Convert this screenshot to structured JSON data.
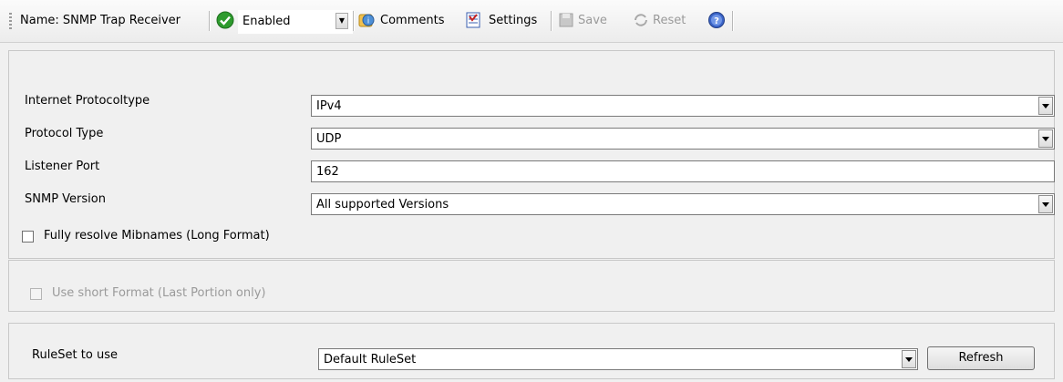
{
  "toolbar": {
    "name_label": "Name: SNMP Trap Receiver",
    "status_value": "Enabled",
    "comments_label": "Comments",
    "settings_label": "Settings",
    "save_label": "Save",
    "reset_label": "Reset"
  },
  "form": {
    "protocoltype": {
      "label": "Internet Protocoltype",
      "value": "IPv4"
    },
    "protocol": {
      "label": "Protocol Type",
      "value": "UDP"
    },
    "port": {
      "label": "Listener Port",
      "value": "162"
    },
    "snmp_version": {
      "label": "SNMP Version",
      "value": "All supported Versions"
    },
    "resolve_mibnames": {
      "label": "Fully resolve Mibnames (Long Format)",
      "checked": false
    },
    "short_format": {
      "label": "Use short Format (Last Portion only)",
      "checked": false,
      "disabled": true
    },
    "ruleset": {
      "label": "RuleSet to use",
      "value": "Default RuleSet",
      "refresh_label": "Refresh"
    }
  },
  "colors": {
    "enabled_green": "#2e9b2e",
    "help_blue": "#3a64c8"
  }
}
